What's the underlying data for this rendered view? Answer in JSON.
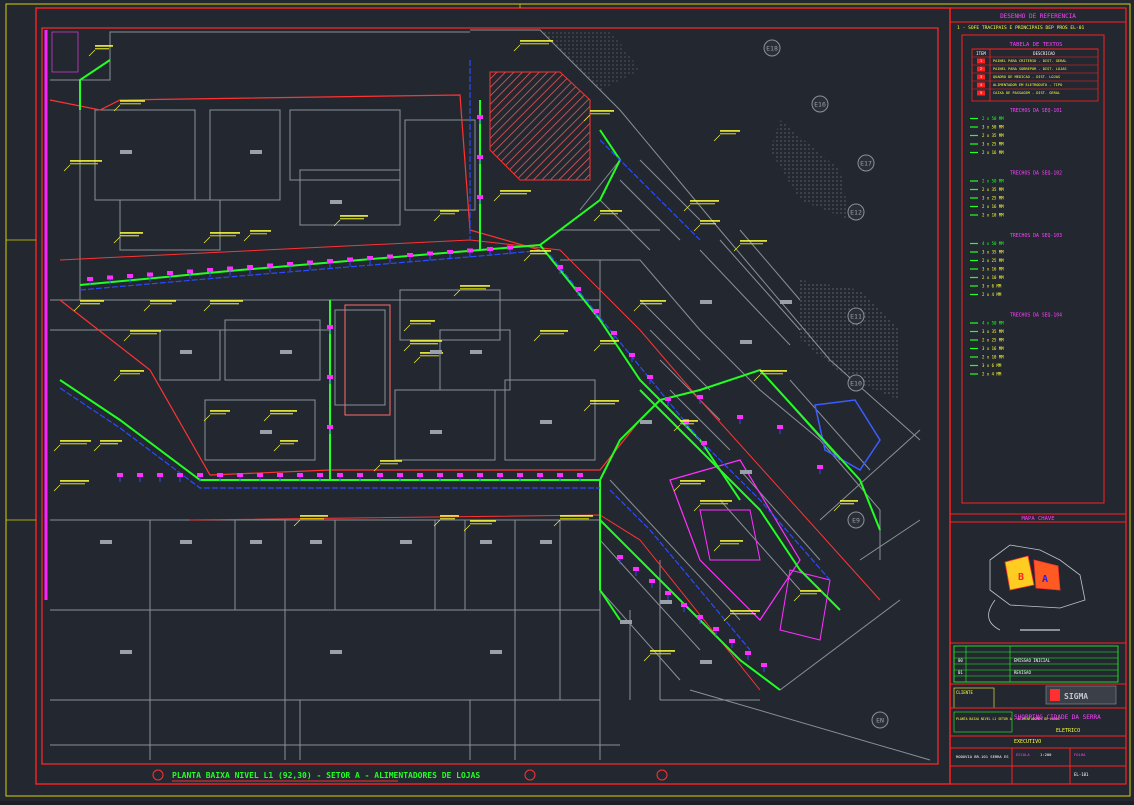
{
  "drawing": {
    "bottom_title": "PLANTA BAIXA NIVEL L1 (92,30) - SETOR A - ALIMENTADORES DE LOJAS",
    "colors": {
      "background": "#232830",
      "border": "#ff2020",
      "green_feeder": "#22ff22",
      "blue_feeder": "#2a4bff",
      "magenta": "#ff20ff",
      "yellow_text": "#ffff3c",
      "gray_walls": "#8a8f98"
    },
    "grid_bubbles": [
      "E18",
      "E16",
      "E17",
      "E12",
      "E11",
      "E10",
      "E9",
      "EN"
    ],
    "zone_labels": [
      "B",
      "A"
    ]
  },
  "reference": {
    "header": "DESENHO DE REFERENCIA",
    "note": "1 - SOFE TRACIPAIS E PRINCIPAIS DEP PROS EL-01"
  },
  "legend": {
    "title": "TABELA DE TEXTOS",
    "col_item": "ITEM",
    "col_desc": "DESCRICAO",
    "rows": [
      {
        "item": "1",
        "text": "PAINEL PARA CRITERIO - DIST. GERAL"
      },
      {
        "item": "2",
        "text": "PAINEL PARA SOBREPOR - DIST. LOJAS"
      },
      {
        "item": "3",
        "text": "QUADRO DE MEDICAO - DIST. LOJAS"
      },
      {
        "item": "4",
        "text": "ALIMENTADOR EM ELETRODUTO - TIPO"
      },
      {
        "item": "5",
        "text": "CAIXA DE PASSAGEM - DIST. GERAL"
      }
    ],
    "sections": [
      {
        "title": "TRECHOS DA SEQ-101",
        "lines": [
          "2 x 50 MM",
          "3 x 50 MM",
          "2 x 35 MM",
          "3 x 25 MM",
          "2 x 16 MM"
        ]
      },
      {
        "title": "TRECHOS DA SEQ-102",
        "lines": [
          "2 x 50 MM",
          "2 x 35 MM",
          "3 x 25 MM",
          "2 x 16 MM",
          "2 x 10 MM"
        ]
      },
      {
        "title": "TRECHOS DA SEQ-103",
        "lines": [
          "4 x 50 MM",
          "3 x 35 MM",
          "2 x 25 MM",
          "3 x 16 MM",
          "2 x 10 MM",
          "3 x 6 MM",
          "2 x 4 MM"
        ]
      },
      {
        "title": "TRECHOS DA SEQ-104",
        "lines": [
          "4 x 50 MM",
          "3 x 35 MM",
          "2 x 25 MM",
          "3 x 16 MM",
          "2 x 10 MM",
          "3 x 6 MM",
          "2 x 4 MM"
        ]
      }
    ]
  },
  "key_map": {
    "title": "MAPA CHAVE"
  },
  "title_block": {
    "revisions": [
      {
        "rev": "00",
        "desc": "EMISSAO INICIAL"
      },
      {
        "rev": "01",
        "desc": "REVISAO"
      }
    ],
    "client_label": "CLIENTE",
    "company": "SIGMA",
    "project": "SHOPPING CIDADE DA SERRA",
    "discipline": "ELETRICO",
    "phase": "EXECUTIVO",
    "sheet_desc": "PLANTA BAIXA NIVEL L1 SETOR A - ALIMENTADORES DE LOJAS",
    "address": "RODOVIA BR-101 SERRA ES",
    "scale_label": "ESCALA",
    "scale": "1:200",
    "sheet_label": "FOLHA",
    "sheet_no": "EL-101"
  }
}
